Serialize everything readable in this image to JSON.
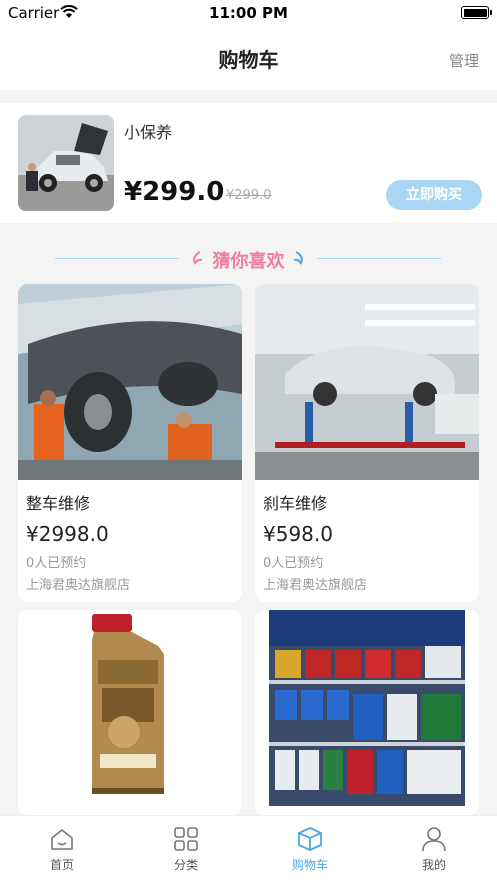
{
  "status_bar": {
    "carrier": "Carrier",
    "time": "11:00 PM"
  },
  "nav": {
    "title": "购物车",
    "manage": "管理"
  },
  "cart": {
    "items": [
      {
        "name": "小保养",
        "price": "¥299.0",
        "original_price": "¥299.0",
        "buy_label": "立即购买"
      }
    ]
  },
  "recommend": {
    "title": "猜你喜欢",
    "products": [
      {
        "name": "整车维修",
        "price": "¥2998.0",
        "booked": "0人已预约",
        "store": "上海君奥达旗舰店"
      },
      {
        "name": "刹车维修",
        "price": "¥598.0",
        "booked": "0人已预约",
        "store": "上海君奥达旗舰店"
      },
      {
        "name": "",
        "price": "",
        "booked": "",
        "store": ""
      },
      {
        "name": "",
        "price": "",
        "booked": "",
        "store": ""
      }
    ]
  },
  "tabbar": {
    "tabs": [
      {
        "label": "首页",
        "icon": "home-icon"
      },
      {
        "label": "分类",
        "icon": "category-grid-icon"
      },
      {
        "label": "购物车",
        "icon": "cart-box-icon",
        "active": true
      },
      {
        "label": "我的",
        "icon": "user-icon"
      }
    ]
  },
  "colors": {
    "accent": "#4aa7df",
    "buy_button": "#a9d6f3",
    "recommend_title": "#f07e9b"
  }
}
